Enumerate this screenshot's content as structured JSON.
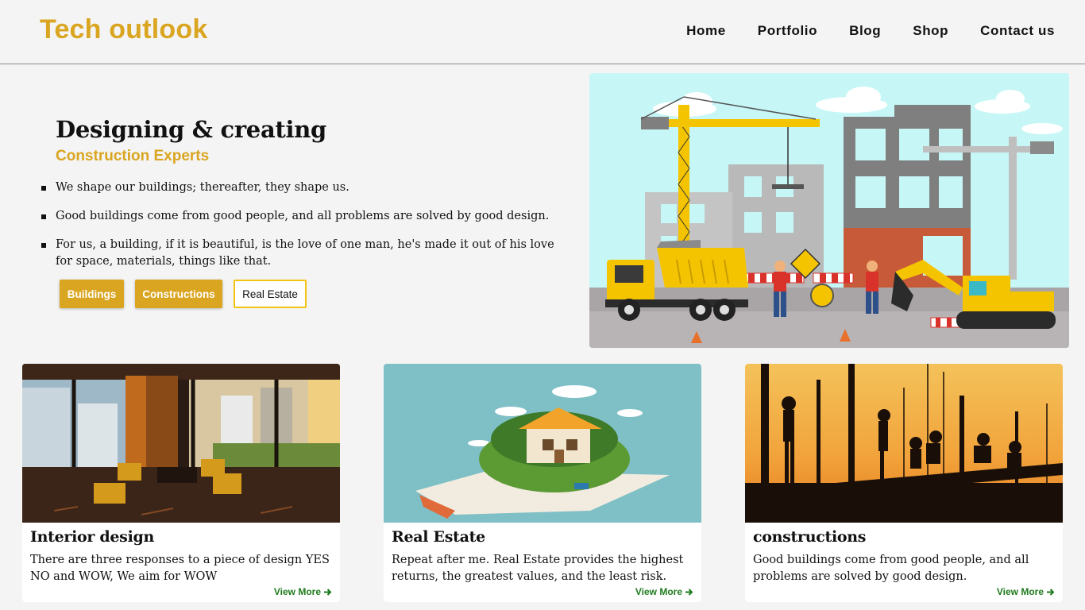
{
  "header": {
    "logo": "Tech outlook",
    "nav": [
      "Home",
      "Portfolio",
      "Blog",
      "Shop",
      "Contact us"
    ]
  },
  "hero": {
    "title": "Designing & creating",
    "subtitle": "Construction Experts",
    "bullets": [
      "We shape our buildings; thereafter, they shape us.",
      "Good buildings come from good people, and all problems are solved by good design.",
      "For us, a building, if it is beautiful, is the love of one man, he's made it out of his love for space, materials, things like that."
    ],
    "buttons": [
      "Buildings",
      "Constructions",
      "Real Estate"
    ]
  },
  "cards": [
    {
      "title": "Interior design",
      "text": "There are three responses to a piece of design YES NO and WOW, We aim for WOW",
      "more": "View More"
    },
    {
      "title": "Real Estate",
      "text": "Repeat after me. Real Estate provides the highest returns, the greatest values, and the least risk.",
      "more": "View More"
    },
    {
      "title": "constructions",
      "text": "Good buildings come from good people, and all problems are solved by good design.",
      "more": "View More"
    }
  ],
  "colors": {
    "accent": "#daa520",
    "link": "#1e7b1e",
    "background": "#f4f4f4"
  },
  "icons": [
    "arrow-right-icon"
  ]
}
